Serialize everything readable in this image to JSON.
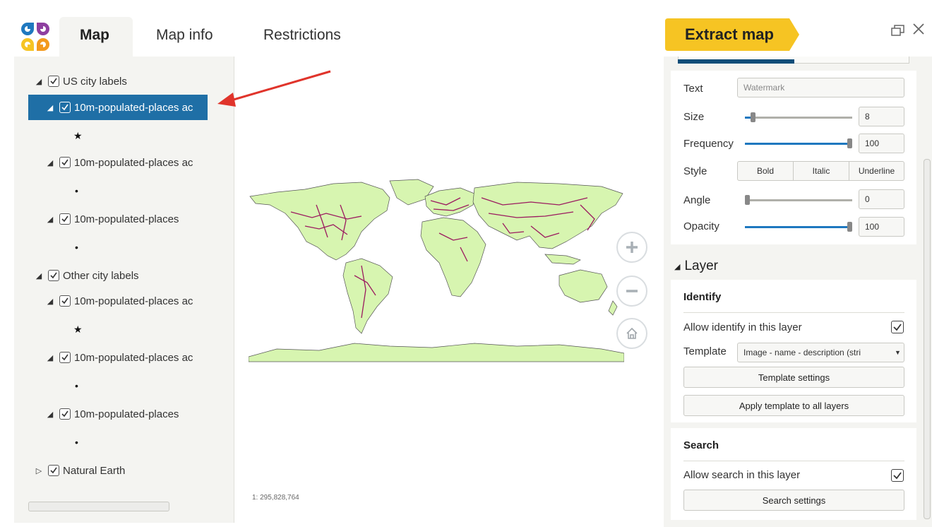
{
  "tabs": {
    "map": "Map",
    "map_info": "Map info",
    "restrictions": "Restrictions"
  },
  "extract_button": "Extract map",
  "tree": {
    "items": [
      {
        "label": "US city labels",
        "caret": "expanded",
        "checked": true,
        "level": 0
      },
      {
        "label": "10m-populated-places ac",
        "caret": "expanded",
        "checked": true,
        "level": 1,
        "selected": true
      },
      {
        "label": "10m-populated-places ac",
        "caret": "expanded",
        "checked": true,
        "level": 1
      },
      {
        "label": "10m-populated-places",
        "caret": "expanded",
        "checked": true,
        "level": 1
      },
      {
        "label": "Other city labels",
        "caret": "expanded",
        "checked": true,
        "level": 0
      },
      {
        "label": "10m-populated-places ac",
        "caret": "expanded",
        "checked": true,
        "level": 1
      },
      {
        "label": "10m-populated-places ac",
        "caret": "expanded",
        "checked": true,
        "level": 1
      },
      {
        "label": "10m-populated-places",
        "caret": "expanded",
        "checked": true,
        "level": 1
      },
      {
        "label": "Natural Earth",
        "caret": "collapsed",
        "checked": true,
        "level": 0
      }
    ],
    "symbols": [
      "★",
      "•",
      "•",
      "★",
      "•",
      "•"
    ]
  },
  "map": {
    "scale": "1: 295,828,764"
  },
  "watermark": {
    "text_label": "Text",
    "text_placeholder": "Watermark",
    "size_label": "Size",
    "size_value": "8",
    "size_fraction": 0.08,
    "frequency_label": "Frequency",
    "frequency_value": "100",
    "frequency_fraction": 1.0,
    "style_label": "Style",
    "style_options": [
      "Bold",
      "Italic",
      "Underline"
    ],
    "angle_label": "Angle",
    "angle_value": "0",
    "angle_fraction": 0.0,
    "opacity_label": "Opacity",
    "opacity_value": "100",
    "opacity_fraction": 1.0
  },
  "layer": {
    "section_title": "Layer",
    "identify_title": "Identify",
    "allow_identify_label": "Allow identify in this layer",
    "allow_identify_checked": true,
    "template_label": "Template",
    "template_value": "Image - name - description (stri",
    "template_settings_button": "Template settings",
    "apply_template_button": "Apply template to all layers",
    "search_title": "Search",
    "allow_search_label": "Allow search in this layer",
    "allow_search_checked": true,
    "search_settings_button": "Search settings"
  },
  "colors": {
    "selection": "#1f6fa6",
    "accent_yellow": "#f6c423",
    "slider_blue": "#1f78bf",
    "land": "#d7f5b0",
    "roads": "#9b1a5f",
    "arrow": "#e0342b"
  }
}
